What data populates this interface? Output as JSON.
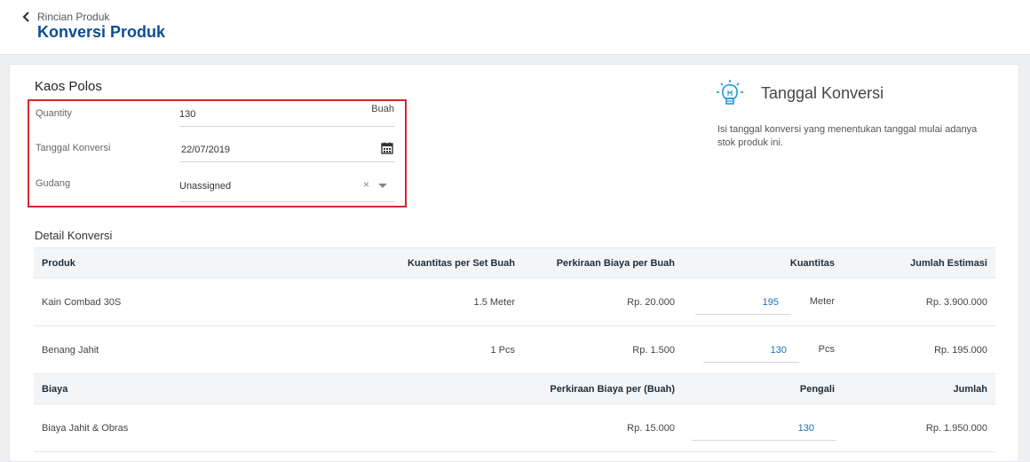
{
  "header": {
    "breadcrumb": "Rincian Produk",
    "title": "Konversi Produk"
  },
  "form": {
    "product_name": "Kaos Polos",
    "quantity_label": "Quantity",
    "quantity_value": "130",
    "quantity_unit": "Buah",
    "date_label": "Tanggal Konversi",
    "date_value": "22/07/2019",
    "warehouse_label": "Gudang",
    "warehouse_value": "Unassigned",
    "clear_symbol": "×"
  },
  "info": {
    "title": "Tanggal Konversi",
    "text": "Isi tanggal konversi yang menentukan tanggal mulai adanya stok produk ini."
  },
  "detail": {
    "title": "Detail Konversi",
    "headers": {
      "product": "Produk",
      "qty_per_set": "Kuantitas per Set Buah",
      "est_cost": "Perkiraan Biaya per Buah",
      "qty": "Kuantitas",
      "total": "Jumlah Estimasi"
    },
    "rows": [
      {
        "product": "Kain Combad 30S",
        "qty_per_set": "1.5 Meter",
        "est_cost": "Rp. 20.000",
        "qty": "195",
        "unit": "Meter",
        "total": "Rp. 3.900.000"
      },
      {
        "product": "Benang Jahit",
        "qty_per_set": "1 Pcs",
        "est_cost": "Rp. 1.500",
        "qty": "130",
        "unit": "Pcs",
        "total": "Rp. 195.000"
      }
    ],
    "cost_headers": {
      "cost": "Biaya",
      "est_cost": "Perkiraan Biaya per (Buah)",
      "multiplier": "Pengali",
      "total": "Jumlah"
    },
    "cost_rows": [
      {
        "cost": "Biaya Jahit & Obras",
        "est_cost": "Rp. 15.000",
        "multiplier": "130",
        "total": "Rp. 1.950.000"
      }
    ]
  }
}
